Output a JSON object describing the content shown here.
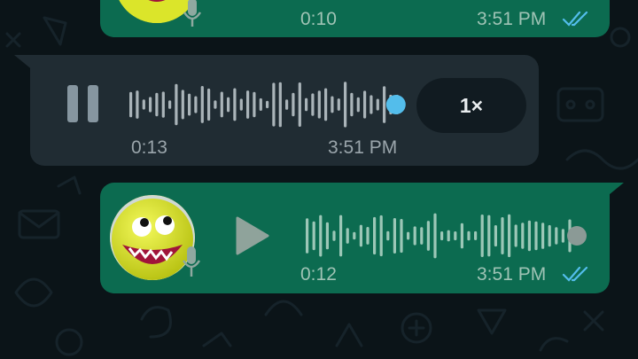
{
  "messages": [
    {
      "direction": "outgoing",
      "duration": "0:10",
      "time": "3:51 PM",
      "status_icon": "double-check-icon",
      "played": true
    },
    {
      "direction": "incoming",
      "duration": "0:13",
      "time": "3:51 PM",
      "state": "playing",
      "speed": "1×",
      "progress": 0.97
    },
    {
      "direction": "outgoing",
      "duration": "0:12",
      "time": "3:51 PM",
      "status_icon": "double-check-icon",
      "state": "paused",
      "progress": 1.0
    }
  ],
  "colors": {
    "outgoing_bubble": "#0c6b50",
    "incoming_bubble": "#202c33",
    "accent_blue": "#53bdeb",
    "background": "#0b1418"
  }
}
